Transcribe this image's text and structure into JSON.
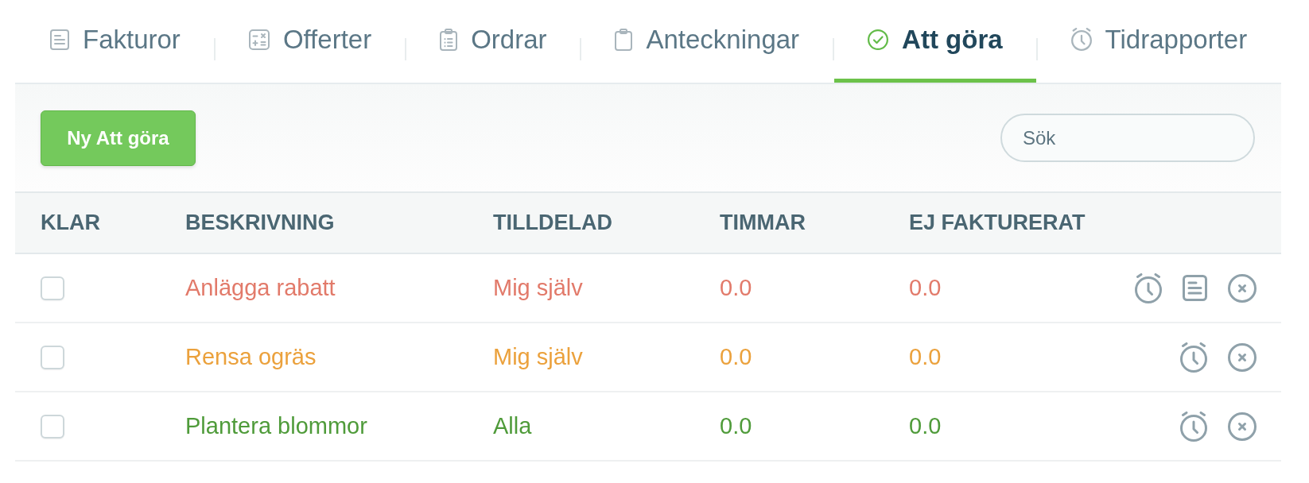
{
  "tabs": [
    {
      "label": "Fakturor",
      "selected": false
    },
    {
      "label": "Offerter",
      "selected": false
    },
    {
      "label": "Ordrar",
      "selected": false
    },
    {
      "label": "Anteckningar",
      "selected": false
    },
    {
      "label": "Att göra",
      "selected": true
    },
    {
      "label": "Tidrapporter",
      "selected": false
    }
  ],
  "toolbar": {
    "new_button": "Ny Att göra",
    "search": {
      "placeholder": "Sök"
    }
  },
  "table": {
    "columns": [
      "KLAR",
      "BESKRIVNING",
      "TILLDELAD",
      "TIMMAR",
      "EJ FAKTURERAT"
    ],
    "rows": [
      {
        "checked": false,
        "description": "Anlägga rabatt",
        "assigned": "Mig själv",
        "hours": "0.0",
        "unbilled": "0.0",
        "color": "#e27a6a",
        "has_note": true
      },
      {
        "checked": false,
        "description": "Rensa ogräs",
        "assigned": "Mig själv",
        "hours": "0.0",
        "unbilled": "0.0",
        "color": "#eba13c",
        "has_note": false
      },
      {
        "checked": false,
        "description": "Plantera blommor",
        "assigned": "Alla",
        "hours": "0.0",
        "unbilled": "0.0",
        "color": "#4f9b3a",
        "has_note": false
      }
    ]
  }
}
